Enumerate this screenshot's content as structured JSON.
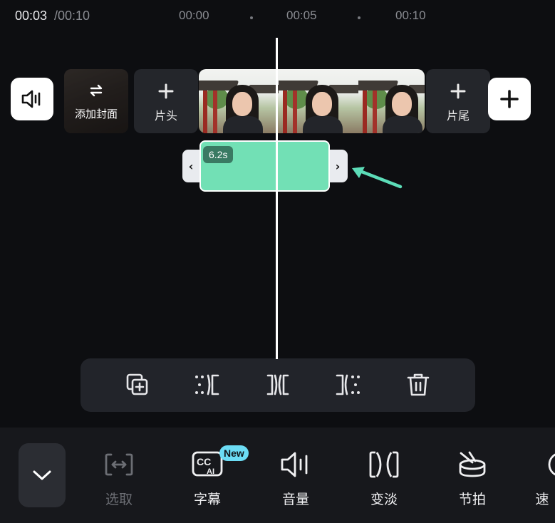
{
  "timeline": {
    "current_time": "00:03",
    "total_time": "/00:10",
    "ticks": [
      "00:00",
      "00:05",
      "00:10"
    ]
  },
  "track": {
    "cover_label": "添加封面",
    "intro_label": "片头",
    "outro_label": "片尾"
  },
  "clip": {
    "duration": "6.2s",
    "color": "#72e0b5",
    "left_handle": "‹",
    "right_handle": "›"
  },
  "annotation": {
    "arrow_color": "#5cdcb8"
  },
  "clip_toolbar": {
    "icons": [
      "copy-icon",
      "split-left-icon",
      "split-icon",
      "split-right-icon",
      "delete-icon"
    ]
  },
  "bottom_bar": {
    "tools": [
      {
        "icon": "select-icon",
        "label": "选取",
        "enabled": false
      },
      {
        "icon": "caption-ai-icon",
        "label": "字幕",
        "enabled": true
      },
      {
        "icon": "volume-icon",
        "label": "音量",
        "enabled": true
      },
      {
        "icon": "fade-icon",
        "label": "变淡",
        "enabled": true
      },
      {
        "icon": "beat-icon",
        "label": "节拍",
        "enabled": true
      },
      {
        "icon": "speed-icon",
        "label": "速",
        "enabled": true
      }
    ],
    "new_badge": "New"
  }
}
